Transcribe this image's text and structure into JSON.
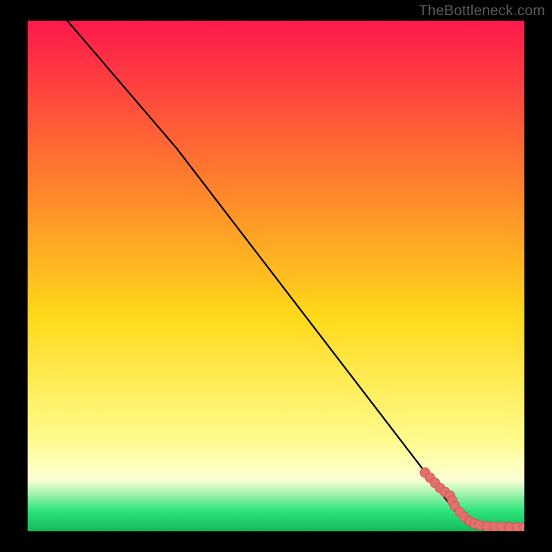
{
  "watermark": "TheBottleneck.com",
  "colors": {
    "background": "#000000",
    "gradient_top": "#ff184c",
    "gradient_mid_upper": "#ff7a2e",
    "gradient_mid": "#ffd91a",
    "gradient_mid_lower": "#fffc8c",
    "gradient_band": "#fdffd5",
    "gradient_green": "#2de47a",
    "line": "#000000",
    "marker_fill": "#e46f6b",
    "marker_stroke": "#c85a55"
  },
  "chart_data": {
    "type": "line",
    "title": "",
    "xlabel": "",
    "ylabel": "",
    "xlim": [
      0,
      100
    ],
    "ylim": [
      0,
      100
    ],
    "series": [
      {
        "name": "curve",
        "x": [
          8,
          30,
          86,
          90,
          94,
          100
        ],
        "y": [
          100,
          75,
          4,
          1.5,
          0.8,
          0.8
        ]
      },
      {
        "name": "markers",
        "type": "scatter",
        "x": [
          80,
          81,
          82,
          83,
          84,
          85,
          85.5,
          86,
          87,
          88,
          89,
          90,
          91,
          92.5,
          94,
          95.5,
          97,
          98.5,
          100
        ],
        "y": [
          11.5,
          10.5,
          9.5,
          8.5,
          7.7,
          7.0,
          6.0,
          5.0,
          3.8,
          2.8,
          2.0,
          1.5,
          1.2,
          1.0,
          0.9,
          0.9,
          0.8,
          0.8,
          0.8
        ]
      }
    ]
  }
}
